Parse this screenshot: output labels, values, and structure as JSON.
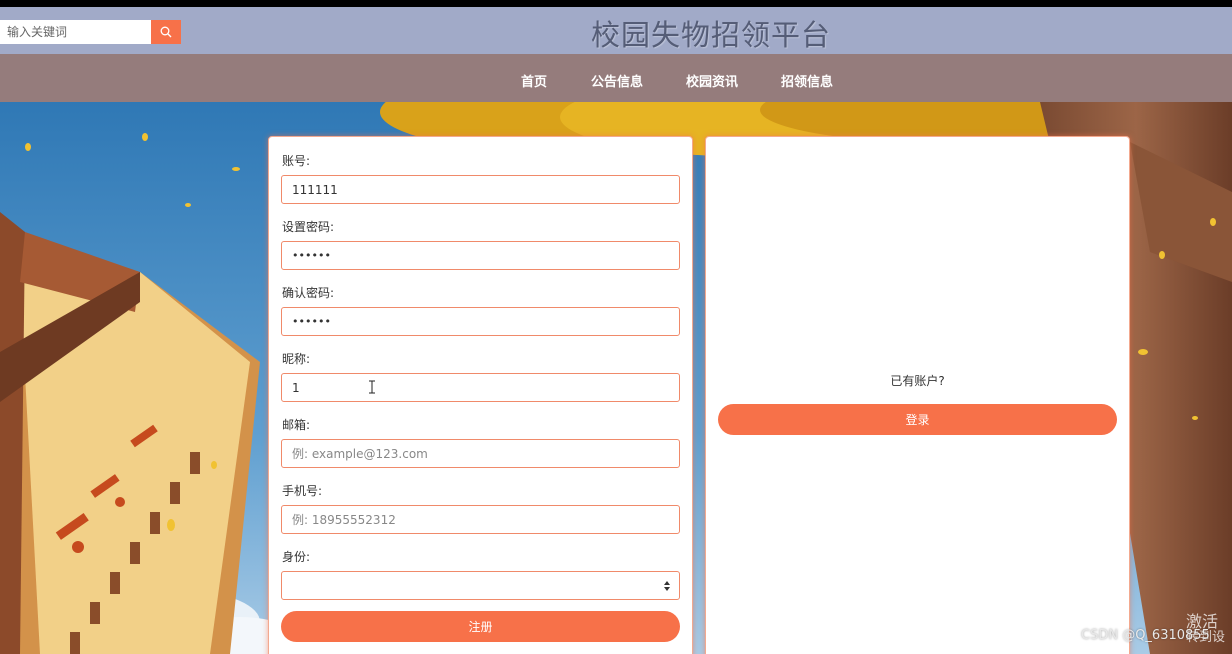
{
  "header": {
    "search_placeholder": "输入关键词",
    "title": "校园失物招领平台"
  },
  "nav": {
    "items": [
      "首页",
      "公告信息",
      "校园资讯",
      "招领信息"
    ]
  },
  "register_form": {
    "account_label": "账号:",
    "account_value": "111111",
    "password_label": "设置密码:",
    "password_value": "••••••",
    "confirm_label": "确认密码:",
    "confirm_value": "••••••",
    "nickname_label": "昵称:",
    "nickname_value": "1",
    "email_label": "邮箱:",
    "email_placeholder": "例: example@123.com",
    "phone_label": "手机号:",
    "phone_placeholder": "例: 18955552312",
    "role_label": "身份:",
    "role_value": "",
    "submit_label": "注册"
  },
  "login_panel": {
    "prompt": "已有账户?",
    "login_label": "登录"
  },
  "overlay": {
    "watermark": "CSDN @Q_6310855",
    "activate_line1": "激活",
    "activate_line2": "转到设"
  },
  "colors": {
    "accent": "#f77149",
    "header_bg": "#a1aac8",
    "nav_bg": "#957c7c",
    "title_color": "#555d77"
  }
}
